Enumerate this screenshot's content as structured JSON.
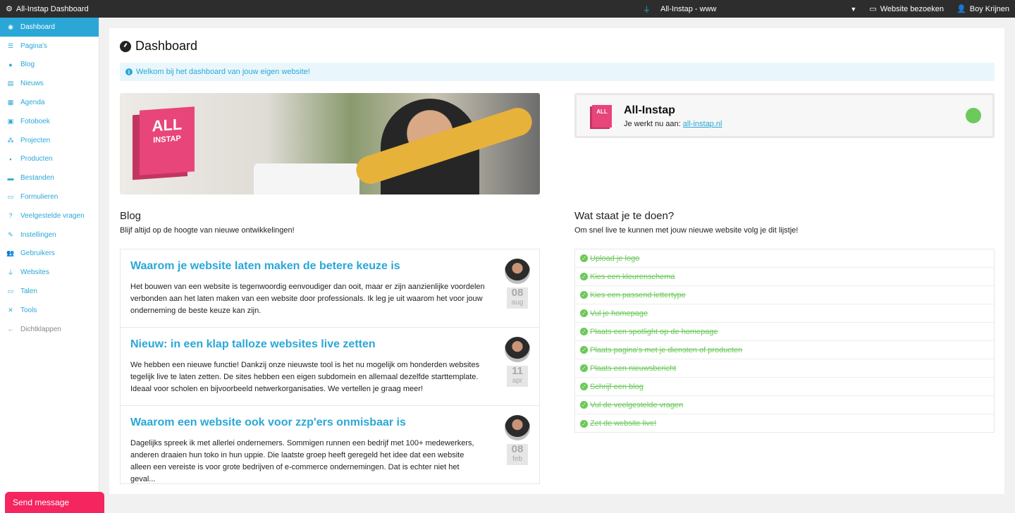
{
  "topbar": {
    "app_title": "All-Instap Dashboard",
    "site_name": "All-Instap - www",
    "visit_label": "Website bezoeken",
    "user_name": "Boy Krijnen"
  },
  "sidebar": {
    "items": [
      {
        "label": "Dashboard",
        "icon": "dashboard-icon"
      },
      {
        "label": "Pagina's",
        "icon": "list-icon"
      },
      {
        "label": "Blog",
        "icon": "globe-icon"
      },
      {
        "label": "Nieuws",
        "icon": "newspaper-icon"
      },
      {
        "label": "Agenda",
        "icon": "calendar-icon"
      },
      {
        "label": "Fotoboek",
        "icon": "image-icon"
      },
      {
        "label": "Projecten",
        "icon": "sitemap-icon"
      },
      {
        "label": "Producten",
        "icon": "cubes-icon"
      },
      {
        "label": "Bestanden",
        "icon": "folder-icon"
      },
      {
        "label": "Formulieren",
        "icon": "form-icon"
      },
      {
        "label": "Veelgestelde vragen",
        "icon": "question-icon"
      },
      {
        "label": "Instellingen",
        "icon": "edit-icon"
      },
      {
        "label": "Gebruikers",
        "icon": "users-icon"
      },
      {
        "label": "Websites",
        "icon": "plug-icon"
      },
      {
        "label": "Talen",
        "icon": "language-icon"
      },
      {
        "label": "Tools",
        "icon": "tools-icon"
      },
      {
        "label": "Dichtklappen",
        "icon": "arrow-left-icon"
      }
    ]
  },
  "page": {
    "title": "Dashboard",
    "welcome": "Welkom bij het dashboard van jouw eigen website!"
  },
  "site_card": {
    "logo_text_1": "ALL",
    "logo_text_2": "INSTAP",
    "name": "All-Instap",
    "working_on_label": "Je werkt nu aan:",
    "domain": "all-instap.nl",
    "status_color": "#6cc95b"
  },
  "blog": {
    "title": "Blog",
    "subtitle": "Blijf altijd op de hoogte van nieuwe ontwikkelingen!",
    "posts": [
      {
        "title": "Waarom je website laten maken de betere keuze is",
        "excerpt": "Het bouwen van een website is tegenwoordig eenvoudiger dan ooit, maar er zijn aanzienlijke voordelen verbonden aan het laten maken van een website door professionals. Ik leg je uit waarom het voor jouw onderneming de beste keuze kan zijn.",
        "day": "08",
        "month": "aug"
      },
      {
        "title": "Nieuw: in een klap talloze websites live zetten",
        "excerpt": "We hebben een nieuwe functie! Dankzij onze nieuwste tool is het nu mogelijk om honderden websites tegelijk live te laten zetten. De sites hebben een eigen subdomein en allemaal dezelfde starttemplate. Ideaal voor scholen en bijvoorbeeld netwerkorganisaties. We vertellen je graag meer!",
        "day": "11",
        "month": "apr"
      },
      {
        "title": "Waarom een website ook voor zzp'ers onmisbaar is",
        "excerpt": "Dagelijks spreek ik met allerlei ondernemers. Sommigen runnen een bedrijf met 100+ medewerkers, anderen draaien hun toko in hun uppie. Die laatste groep heeft geregeld het idee dat een website alleen een vereiste is voor grote bedrijven of e-commerce ondernemingen. Dat is echter niet het geval...",
        "day": "08",
        "month": "feb"
      }
    ]
  },
  "todo": {
    "title": "Wat staat je te doen?",
    "subtitle": "Om snel live te kunnen met jouw nieuwe website volg je dit lijstje!",
    "items": [
      "Upload je logo",
      "Kies een kleurenschema",
      "Kies een passend lettertype",
      "Vul je homepage",
      "Plaats een spotlight op de homepage",
      "Plaats pagina's met je diensten of producten",
      "Plaats een nieuwsbericht",
      "Schrijf een blog",
      "Vul de veelgestelde vragen",
      "Zet de website live!"
    ]
  },
  "send_message": "Send message",
  "colors": {
    "accent": "#2aa7d7",
    "done": "#6cc95b",
    "brand_pink": "#e8457a",
    "send_button": "#f4255f"
  }
}
